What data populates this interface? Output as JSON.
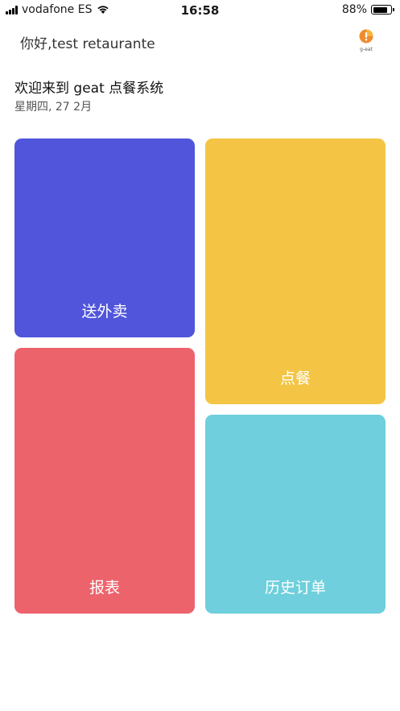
{
  "status_bar": {
    "carrier": "vodafone ES",
    "time": "16:58",
    "battery_percent_text": "88%",
    "battery_level": 0.88
  },
  "header": {
    "greeting": "你好,test retaurante",
    "logo_text": "g-eat"
  },
  "welcome": {
    "title": "欢迎来到 geat 点餐系统",
    "date": "星期四, 27  2月"
  },
  "tiles": [
    {
      "label": "送外卖",
      "color": "#5055db"
    },
    {
      "label": "点餐",
      "color": "#f4c545"
    },
    {
      "label": "报表",
      "color": "#ed636c"
    },
    {
      "label": "历史订单",
      "color": "#6fcfdc"
    }
  ]
}
